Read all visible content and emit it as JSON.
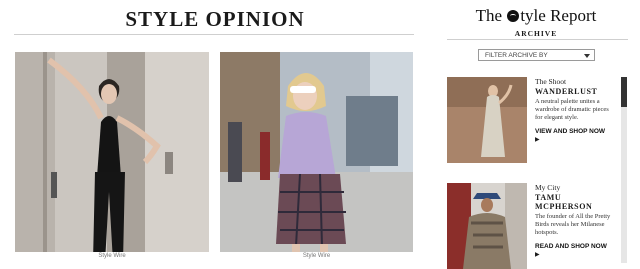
{
  "main": {
    "title": "STYLE OPINION",
    "cards": [
      {
        "caption": "Style Wire"
      },
      {
        "caption": "Style Wire"
      }
    ]
  },
  "sidebar": {
    "brand_before": "The",
    "brand_after": "tyle Report",
    "archive_label": "ARCHIVE",
    "filter": {
      "label": "FILTER ARCHIVE BY"
    },
    "items": [
      {
        "kicker": "The Shoot",
        "title": "WANDERLUST",
        "description": "A neutral palette unites a wardrobe of dramatic pieces for elegant style.",
        "cta": "VIEW AND SHOP NOW",
        "arrow": "▶"
      },
      {
        "kicker": "My City",
        "title": "TAMU MCPHERSON",
        "description": "The founder of All the Pretty Birds reveals her Milanese hotspots.",
        "cta": "READ AND SHOP NOW",
        "arrow": "▶"
      }
    ]
  },
  "colors": {
    "accent": "#111111",
    "rule": "#cfcfcf"
  },
  "icons": {
    "dropdown": "chevron-down-icon",
    "logo": "style-report-logo-icon"
  }
}
